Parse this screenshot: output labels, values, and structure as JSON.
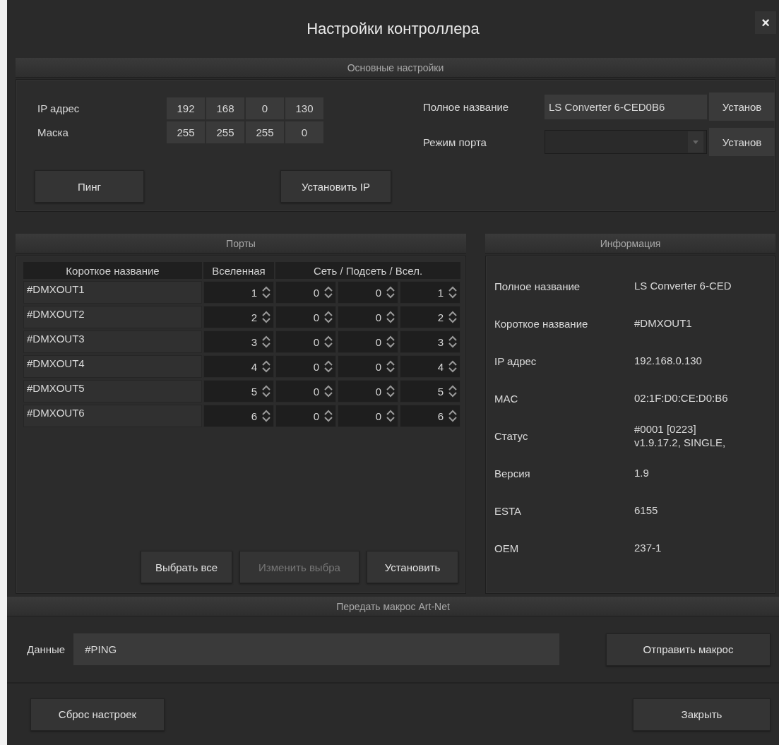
{
  "window": {
    "title": "Настройки контроллера",
    "close": "×"
  },
  "basic": {
    "header": "Основные настройки",
    "ip": {
      "label": "IP адрес",
      "octets": [
        "192",
        "168",
        "0",
        "130"
      ]
    },
    "mask": {
      "label": "Маска",
      "octets": [
        "255",
        "255",
        "255",
        "0"
      ]
    },
    "ping_button": "Пинг",
    "set_ip_button": "Установить IP",
    "full_name": {
      "label": "Полное название",
      "value": "LS Converter 6-CED0B6",
      "button": "Установ"
    },
    "port_mode": {
      "label": "Режим порта",
      "button": "Установ"
    }
  },
  "ports": {
    "header": "Порты",
    "columns": [
      "Короткое название",
      "Вселенная",
      "Сеть / Подсеть / Всел."
    ],
    "rows": [
      {
        "name": "#DMXOUT1",
        "values": [
          "1",
          "0",
          "0",
          "1"
        ]
      },
      {
        "name": "#DMXOUT2",
        "values": [
          "2",
          "0",
          "0",
          "2"
        ]
      },
      {
        "name": "#DMXOUT3",
        "values": [
          "3",
          "0",
          "0",
          "3"
        ]
      },
      {
        "name": "#DMXOUT4",
        "values": [
          "4",
          "0",
          "0",
          "4"
        ]
      },
      {
        "name": "#DMXOUT5",
        "values": [
          "5",
          "0",
          "0",
          "5"
        ]
      },
      {
        "name": "#DMXOUT6",
        "values": [
          "6",
          "0",
          "0",
          "6"
        ]
      }
    ],
    "buttons": [
      {
        "label": "Выбрать все",
        "disabled": false
      },
      {
        "label": "Изменить выбра",
        "disabled": true
      },
      {
        "label": "Установить",
        "disabled": false
      }
    ]
  },
  "info": {
    "header": "Информация",
    "rows": [
      {
        "label": "Полное название",
        "value": "LS Converter 6-CED"
      },
      {
        "label": "Короткое название",
        "value": "#DMXOUT1"
      },
      {
        "label": "IP адрес",
        "value": "192.168.0.130"
      },
      {
        "label": "MAC",
        "value": "02:1F:D0:CE:D0:B6"
      },
      {
        "label": "Статус",
        "value": "#0001 [0223]\nv1.9.17.2, SINGLE,"
      },
      {
        "label": "Версия",
        "value": "1.9"
      },
      {
        "label": "ESTA",
        "value": "6155"
      },
      {
        "label": "OEM",
        "value": "237-1"
      }
    ]
  },
  "macro": {
    "header": "Передать макрос Art-Net",
    "data_label": "Данные",
    "data_value": "#PING",
    "send_button": "Отправить макрос"
  },
  "footer": {
    "reset_button": "Сброс настроек",
    "close_button": "Закрыть"
  }
}
